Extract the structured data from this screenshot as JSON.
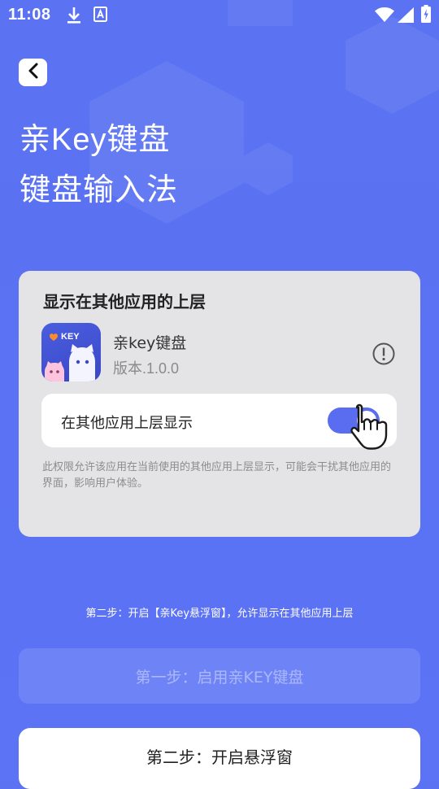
{
  "status_bar": {
    "time": "11:08",
    "icons": [
      "download-icon",
      "keyboard-notification-icon",
      "wifi-icon",
      "signal-icon",
      "battery-charging-icon"
    ]
  },
  "header": {
    "title_line1": "亲Key键盘",
    "title_line2": "键盘输入法"
  },
  "permission_card": {
    "heading": "显示在其他应用的上层",
    "app_name": "亲key键盘",
    "app_version": "版本.1.0.0",
    "icon_text": "KEY",
    "toggle_label": "在其他应用上层显示",
    "toggle_on": true,
    "description": "此权限允许该应用在当前使用的其他应用上层显示，可能会干扰其他应用的界面，影响用户体验。"
  },
  "step_hint": "第二步：开启【亲Key悬浮窗】，允许显示在其他应用上层",
  "buttons": {
    "step1": "第一步：启用亲KEY键盘",
    "step2": "第二步：开启悬浮窗"
  },
  "colors": {
    "background": "#5b73f2",
    "toggle_accent": "#5a6cf0",
    "card": "#e4e4e6"
  }
}
